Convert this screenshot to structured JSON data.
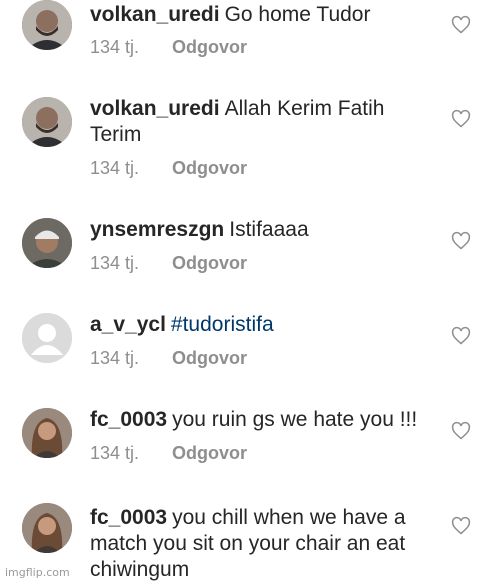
{
  "comments": [
    {
      "username": "volkan_uredi",
      "text": "Go home Tudor",
      "time": "134 tj.",
      "reply": "Odgovor",
      "avatar": "man-bald-beard"
    },
    {
      "username": "volkan_uredi",
      "text": "Allah Kerim Fatih Terim",
      "time": "134 tj.",
      "reply": "Odgovor",
      "avatar": "man-bald-beard"
    },
    {
      "username": "ynsemreszgn",
      "text": "Istifaaaa",
      "time": "134 tj.",
      "reply": "Odgovor",
      "avatar": "man-cap"
    },
    {
      "username": "a_v_ycl",
      "text": "#tudoristifa",
      "time": "134 tj.",
      "reply": "Odgovor",
      "avatar": "default-silhouette"
    },
    {
      "username": "fc_0003",
      "text": "you ruin gs we hate you !!!",
      "time": "134 tj.",
      "reply": "Odgovor",
      "avatar": "woman-long-hair"
    },
    {
      "username": "fc_0003",
      "text": "you chill when we have a match you sit on your chair an eat chiwingum",
      "avatar": "woman-long-hair"
    }
  ],
  "watermark": "imgflip.com",
  "colors": {
    "text": "#262626",
    "meta": "#8e8e8e",
    "hashtag": "#00376b"
  }
}
